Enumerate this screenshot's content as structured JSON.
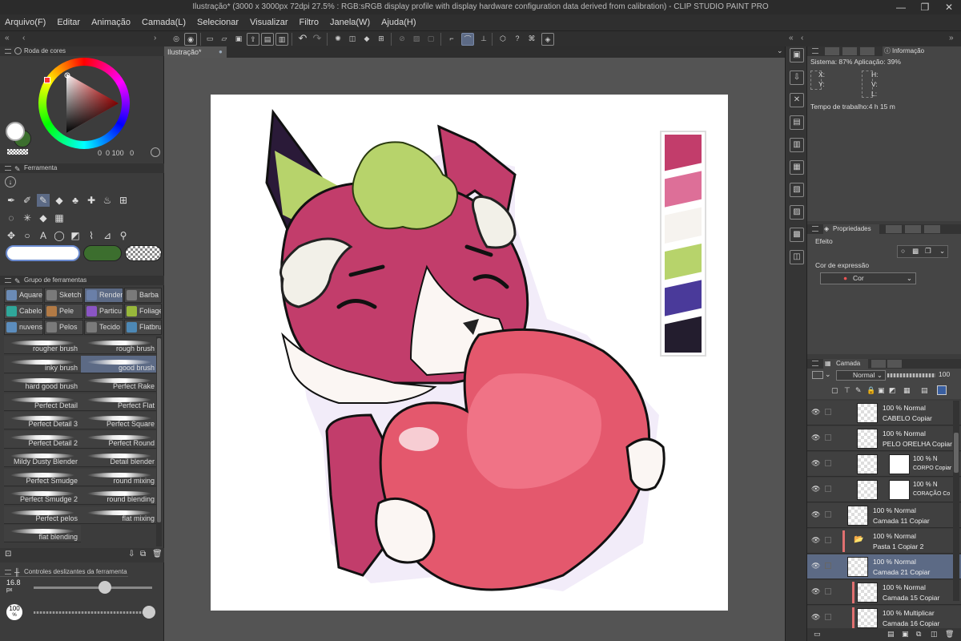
{
  "window": {
    "title": "Ilustração* (3000 x 3000px 72dpi 27.5% : RGB:sRGB display profile with display hardware configuration data derived from calibration) - CLIP STUDIO PAINT PRO",
    "minimize": "—",
    "maximize": "❐",
    "close": "✕"
  },
  "menu": [
    "Arquivo(F)",
    "Editar",
    "Animação",
    "Camada(L)",
    "Selecionar",
    "Visualizar",
    "Filtro",
    "Janela(W)",
    "Ajuda(H)"
  ],
  "canvas_tab": "Ilustração*",
  "color_wheel": {
    "title": "Roda de cores",
    "values": [
      "0",
      "0",
      "100",
      "0"
    ]
  },
  "tool_panel": {
    "title": "Ferramenta"
  },
  "tool_group": {
    "title": "Grupo de ferramentas",
    "groups": [
      {
        "label": "Aquarela",
        "color": "#6b8bb5"
      },
      {
        "label": "Sketch",
        "color": "#7a7a7a"
      },
      {
        "label": "Render",
        "color": "#6a7fa8"
      },
      {
        "label": "Barba",
        "color": "#7a7a7a"
      },
      {
        "label": "Cabelo",
        "color": "#2fa79a"
      },
      {
        "label": "Pele",
        "color": "#b27a45"
      },
      {
        "label": "Particu",
        "color": "#8a55c4"
      },
      {
        "label": "Foliage",
        "color": "#98b83b"
      },
      {
        "label": "nuvens",
        "color": "#5c8dbd"
      },
      {
        "label": "Pelos",
        "color": "#7a7a7a"
      },
      {
        "label": "Tecido",
        "color": "#7a7a7a"
      },
      {
        "label": "Flatbru",
        "color": "#4d88b5"
      }
    ]
  },
  "brushes": [
    [
      "rougher brush",
      "rough brush"
    ],
    [
      "inky brush",
      "good brush"
    ],
    [
      "hard good brush",
      "Perfect Rake"
    ],
    [
      "Perfect Detail",
      "Perfect Flat"
    ],
    [
      "Perfect Detail 3",
      "Perfect Square"
    ],
    [
      "Perfect Detail 2",
      "Perfect Round"
    ],
    [
      "Mildy Dusty Blender",
      "Detail blender"
    ],
    [
      "Perfect Smudge",
      "round mixing"
    ],
    [
      "Perfect Smudge 2",
      "round blending"
    ],
    [
      "Perfect pelos",
      "flat mixing"
    ],
    [
      "flat blending",
      ""
    ]
  ],
  "slider_panel": {
    "title": "Controles deslizantes da ferramenta",
    "size_value": "16.8",
    "size_unit": "px",
    "opacity_value": "100",
    "opacity_unit": "%",
    "size_fraction": 0.6,
    "opacity_fraction": 1.0
  },
  "info_panel": {
    "title": "Informação",
    "system": "Sistema: 87%  Aplicação: 39%",
    "x": "X:",
    "y": "Y:",
    "h": "H:",
    "v": "V:",
    "l": "L:",
    "worktime": "Tempo de trabalho:4 h 15 m"
  },
  "properties_panel": {
    "title": "Propriedades",
    "effect": "Efeito",
    "expression_color": "Cor de expressão",
    "color_mode": "Cor"
  },
  "layer_panel": {
    "title": "Camada",
    "blend_mode": "Normal",
    "opacity": "100",
    "layers": [
      {
        "l1": "100 % Normal",
        "l2": "CABELO Copiar",
        "indent": 1,
        "selected": false,
        "mask": false,
        "red": false
      },
      {
        "l1": "100 % Normal",
        "l2": "PELO ORELHA Copiar",
        "indent": 1,
        "selected": false,
        "mask": false,
        "red": false
      },
      {
        "l1": "100 % N",
        "l2": "CORPO Copiar",
        "indent": 1,
        "selected": false,
        "mask": true,
        "red": false
      },
      {
        "l1": "100 % N",
        "l2": "CORAÇÃO Co",
        "indent": 1,
        "selected": false,
        "mask": true,
        "red": false
      },
      {
        "l1": "100 % Normal",
        "l2": "Camada 11 Copiar",
        "indent": 0,
        "selected": false,
        "mask": false,
        "red": false
      },
      {
        "l1": "100 % Normal",
        "l2": "Pasta 1 Copiar 2",
        "indent": 0,
        "selected": false,
        "mask": false,
        "red": true,
        "folder": true
      },
      {
        "l1": "100 % Normal",
        "l2": "Camada 21 Copiar",
        "indent": 0,
        "selected": true,
        "mask": false,
        "red": false
      },
      {
        "l1": "100 % Normal",
        "l2": "Camada 15 Copiar",
        "indent": 1,
        "selected": false,
        "mask": false,
        "red": true
      },
      {
        "l1": "100 % Multiplicar",
        "l2": "Camada 16 Copiar",
        "indent": 1,
        "selected": false,
        "mask": false,
        "red": true
      }
    ]
  },
  "palette": {
    "colors": [
      "#c23d6b",
      "#dd6f98",
      "#f6f3ef",
      "#b7d36b",
      "#4a3a9a",
      "#231d2e"
    ]
  },
  "colors": {
    "main": "#ffffff",
    "sub": "#3c6e2e",
    "accent": "#5c6a85"
  }
}
